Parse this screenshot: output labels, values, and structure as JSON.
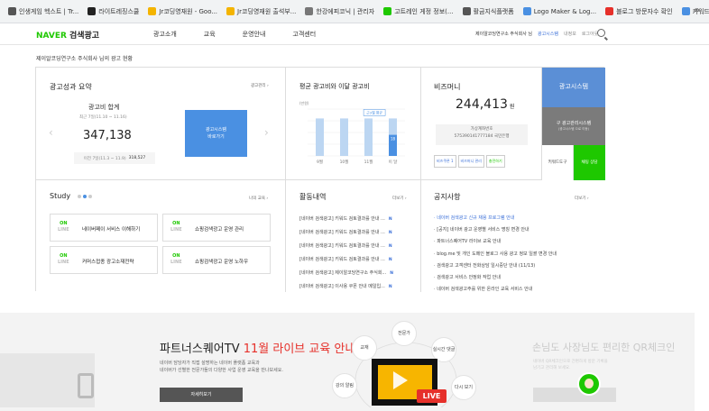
{
  "bookmarks": [
    {
      "label": "인생게임 헥스트 | Tr...",
      "color": "#555"
    },
    {
      "label": "라이트레징스쿨",
      "color": "#222"
    },
    {
      "label": "Jr코딩영재원 - Goo...",
      "color": "#f4b400"
    },
    {
      "label": "Jr코딩영재원 출석부...",
      "color": "#f4b400"
    },
    {
      "label": "한강에피코닉 | 관리자",
      "color": "#777"
    },
    {
      "label": "고트레인 게정 정보(...",
      "color": "#1ec800"
    },
    {
      "label": "활금지식플랫폼",
      "color": "#555"
    },
    {
      "label": "Logo Maker & Log...",
      "color": "#4a90e2"
    },
    {
      "label": "블로그 방문자수 확인",
      "color": "#e6302a"
    },
    {
      "label": "키워드마스터",
      "color": "#4a90e2"
    }
  ],
  "header": {
    "logo": "NAVER",
    "service": "검색광고",
    "menu": [
      "광고소개",
      "교육",
      "운영안내",
      "고객센터"
    ],
    "user": "제이알코딩연구소 주식회사 님",
    "links": [
      "광고시스템",
      "내정보",
      "로그아웃"
    ]
  },
  "greeting": "제이알코딩연구소 주식회사 님의 광고 현황",
  "summary": {
    "title": "광고성과 요약",
    "link": "광고관리 ›",
    "total_label": "광고비 합계",
    "period": "최근 7일(11.10 ~ 11.16)",
    "total_value": "347,138",
    "prev_period": "이전 7일(11.3 ~ 11.9)",
    "prev_value": "318,527",
    "button_line1": "광고시스템",
    "button_line2": "바로가기"
  },
  "avg_cost": {
    "title": "평균 광고비와 이달 광고비",
    "unit": "(만원)",
    "label_avg": "근3월 평균",
    "label_month": "이 달",
    "bar_value": "18"
  },
  "chart_data": {
    "type": "bar",
    "categories": [
      "9월",
      "10월",
      "11월",
      "이 달"
    ],
    "series": [
      {
        "name": "근3월 평균",
        "values": [
          32,
          32,
          32,
          32
        ]
      },
      {
        "name": "이 달",
        "values": [
          null,
          null,
          null,
          18
        ]
      }
    ],
    "xlabel": "",
    "ylabel": "(만원)",
    "ylim": [
      0,
      40
    ],
    "grid": true,
    "colors": [
      "#bcd6f2",
      "#4a90e2"
    ]
  },
  "bizmoney": {
    "title": "비즈머니",
    "amount": "244,413",
    "unit": "원",
    "acct_label": "가상계좌번호",
    "acct_number": "575390141777184 국민은행",
    "buttons": [
      "비즈쿠폰 1",
      "비즈머니 관리",
      "충전하기"
    ]
  },
  "side": {
    "primary": "광고시스템",
    "secondary": "구 광고관리시스템",
    "secondary_sub": "(광고시스템 으로 이동)",
    "tools": "키워드도구",
    "chat": "채팅 상담"
  },
  "study": {
    "title": "Study",
    "link": "나의 교육 ›",
    "badge_top": "ON",
    "badge_bottom": "LINE",
    "cards": [
      "네이버페이 서비스 이해하기",
      "쇼핑검색광고 운영 관리",
      "커머스접종 광고소재전략",
      "쇼핑검색광고 운영 노하우"
    ]
  },
  "activity": {
    "title": "활동내역",
    "link": "더보기 ›",
    "new": "N",
    "items": [
      "[네이버 검색광고] 키워드 검토결과를 안내 ...",
      "[네이버 검색광고] 키워드 검토결과를 안내 ...",
      "[네이버 검색광고] 키워드 검토결과를 안내 ...",
      "[네이버 검색광고] 키워드 검토결과를 안내 ...",
      "[네이버 검색광고] 제이알코딩연구소 주식회...",
      "[네이버 검색광고] 이사용 쿠폰 안내 메일입..."
    ]
  },
  "notice": {
    "title": "공지사항",
    "link": "더보기 ›",
    "items": [
      "네이버 검색광고 신규 채용 프로그램 안내",
      "[공지] 네이버 광고 운영별 서비스 명칭 변경 안내",
      "파트너스퀘어TV 라이브 교육 안내",
      "blog.me 및 개인 도메인 블로그 사용 광고 정보 일괄 변경 안내",
      "검색광고 고객센터 전화상담 일시중단 안내 (11/13)",
      "검색광고 서비스 안정화 작업 안내",
      "네이버 검색광고주를 위한 온라인 교육 서비스 안내"
    ]
  },
  "banner": {
    "title_a": "파트너스퀘어TV ",
    "title_b": "11월 라이브 교육 안내",
    "desc1": "네이버 담당자가 직접 설명하는 네이버 플랫폼 교육과",
    "desc2": "네이버가 선별한 전문가들의 다양한 사업 운영 교육을 만나보세요.",
    "button": "자세히보기",
    "circles": [
      "전문가",
      "교재",
      "실시간 댓글",
      "강의 알림",
      "다시 보기"
    ],
    "live": "LIVE",
    "right_title": "손님도 사장님도 편리한 QR체크인 ",
    "right_sub1": "네이버 QR체크인으로 간편하게 방문 기록을",
    "right_sub2": "남기고 관리해 보세요."
  }
}
